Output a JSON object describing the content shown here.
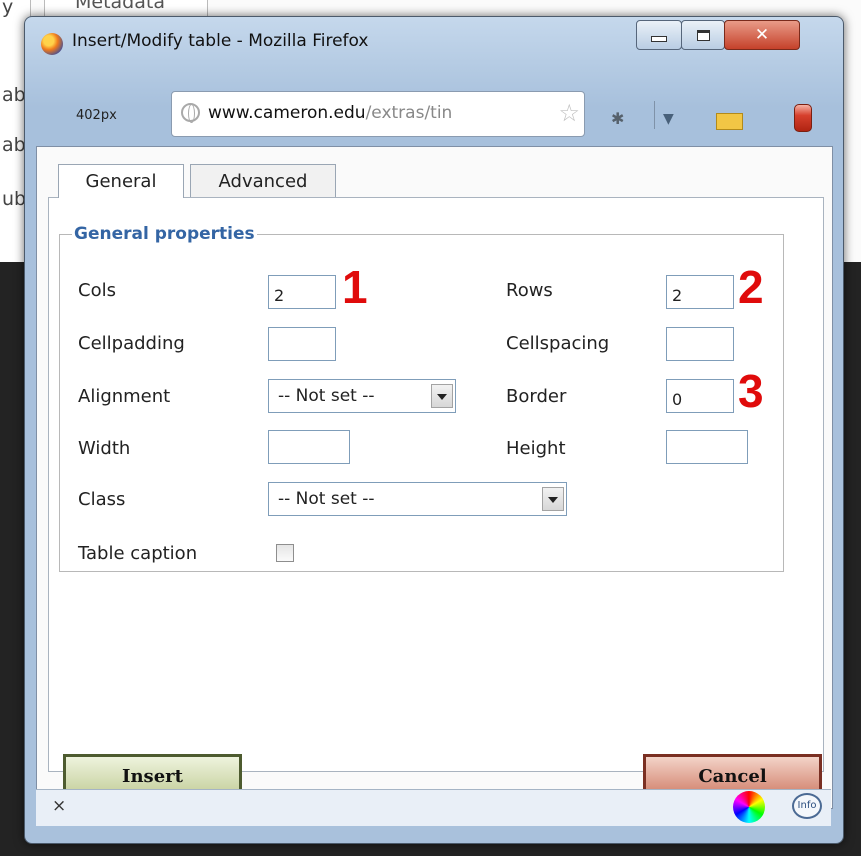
{
  "background": {
    "left_fragments": [
      "y",
      "ab",
      "ab",
      "ub"
    ],
    "header_text": "Metadata"
  },
  "window": {
    "title": "Insert/Modify table - Mozilla Firefox",
    "zoom_text": "402px",
    "url_domain": "www.cameron.edu",
    "url_path": "/extras/tin"
  },
  "tabs": [
    {
      "label": "General",
      "active": true
    },
    {
      "label": "Advanced",
      "active": false
    }
  ],
  "fieldset": {
    "legend": "General properties"
  },
  "fields": {
    "cols": {
      "label": "Cols",
      "value": "2"
    },
    "rows": {
      "label": "Rows",
      "value": "2"
    },
    "cellpadding": {
      "label": "Cellpadding",
      "value": ""
    },
    "cellspacing": {
      "label": "Cellspacing",
      "value": ""
    },
    "alignment": {
      "label": "Alignment",
      "value": "-- Not set --"
    },
    "border": {
      "label": "Border",
      "value": "0"
    },
    "width": {
      "label": "Width",
      "value": ""
    },
    "height": {
      "label": "Height",
      "value": ""
    },
    "class": {
      "label": "Class",
      "value": "-- Not set --"
    },
    "caption": {
      "label": "Table caption",
      "checked": false
    }
  },
  "annotations": [
    "1",
    "2",
    "3"
  ],
  "buttons": {
    "insert": "Insert",
    "cancel": "Cancel"
  },
  "status": {
    "close_glyph": "×",
    "info_text": "Info"
  },
  "colors": {
    "annotation": "#e00b0b",
    "legend": "#3465a4",
    "insert_border": "#4d5b2f",
    "cancel_border": "#7a2f22"
  },
  "icons": [
    "firefox-icon",
    "minimize-icon",
    "maximize-icon",
    "close-icon",
    "globe-icon",
    "star-icon",
    "bug-icon",
    "dropdown-icon",
    "ruler-icon",
    "jar-icon",
    "color-wheel-icon",
    "info-icon"
  ]
}
